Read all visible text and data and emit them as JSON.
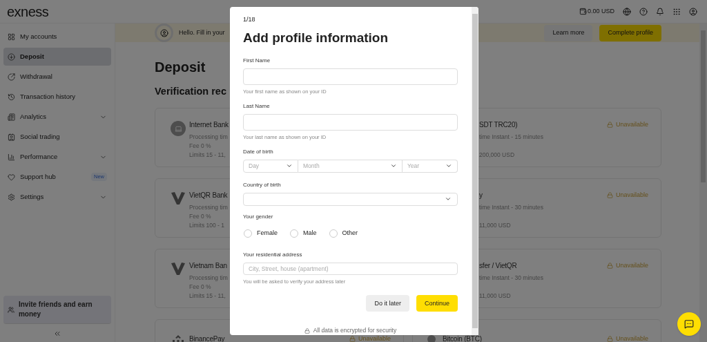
{
  "header": {
    "logo": "exness",
    "balance": "0.00 USD"
  },
  "sidebar": {
    "items": [
      {
        "label": "My accounts",
        "selected": false
      },
      {
        "label": "Deposit",
        "selected": true
      },
      {
        "label": "Withdrawal",
        "selected": false
      },
      {
        "label": "Transaction history",
        "selected": false
      },
      {
        "label": "Analytics",
        "selected": false,
        "expandable": true
      },
      {
        "label": "Social trading",
        "selected": false
      },
      {
        "label": "Performance",
        "selected": false,
        "expandable": true
      },
      {
        "label": "Support hub",
        "selected": false,
        "badge": "New"
      },
      {
        "label": "Settings",
        "selected": false,
        "expandable": true
      }
    ],
    "promo": "Invite friends and earn money"
  },
  "banner": {
    "text": "Hello. Fill in your",
    "buttons": [
      {
        "label": "Learn more",
        "kind": "secondary"
      },
      {
        "label": "Complete profile",
        "kind": "primary"
      }
    ]
  },
  "page": {
    "title": "Deposit",
    "subtitle": "Verification rec"
  },
  "method_rows": [
    {
      "left": {
        "title": "Internet Bank",
        "processing": "Processing tim",
        "fee": "Fee 0 %",
        "limits": "Limits 15 - 11,"
      },
      "right": {
        "title": "SDT TRC20)",
        "processing": "time Instant - 15 minutes",
        "limits": "200,000 USD",
        "status": "Unavailable"
      }
    },
    {
      "left": {
        "title": "VietQR Bank",
        "processing": "Processing tim",
        "fee": "Fee 0 %",
        "limits": "Limits 100 - 1"
      },
      "right": {
        "title": "y",
        "processing": "time Instant - 30 minutes",
        "limits": "11,000 USD",
        "status": "Unavailable"
      }
    },
    {
      "left": {
        "title": "Vietnam Ban",
        "processing": "Processing tim",
        "fee": "Fee 0 %",
        "limits": "Limits 15 - 11,"
      },
      "right": {
        "title": "sfer / VietQR",
        "processing": "time Instant - 30 minutes",
        "limits": "11,000 USD",
        "status": "Unavailable"
      }
    },
    {
      "left": {
        "title": "BinancePay",
        "status": "Unavailable"
      },
      "right": {
        "title": "Bitcoin (BTC)",
        "status": "Unavailable"
      }
    }
  ],
  "modal": {
    "step": "1/18",
    "title": "Add profile information",
    "first_name": {
      "label": "First Name",
      "hint": "Your first name as shown on your ID"
    },
    "last_name": {
      "label": "Last Name",
      "hint": "Your last name as shown on your ID"
    },
    "birth_date": {
      "label": "Date of birth",
      "selects": [
        {
          "placeholder": "Day"
        },
        {
          "placeholder": "Month"
        },
        {
          "placeholder": "Year"
        }
      ]
    },
    "country": {
      "label": "Country of birth"
    },
    "gender": {
      "label": "Your gender",
      "options": [
        {
          "label": "Female",
          "selected": false
        },
        {
          "label": "Male",
          "selected": false
        },
        {
          "label": "Other",
          "selected": false
        }
      ]
    },
    "address": {
      "label": "Your residential address",
      "placeholder": "City, Street, house (apartment)",
      "hint": "You will be asked to verify your address later"
    },
    "buttons": [
      {
        "label": "Do it later",
        "kind": "secondary"
      },
      {
        "label": "Continue",
        "kind": "primary"
      }
    ],
    "security_note": "All data is encrypted for security"
  }
}
